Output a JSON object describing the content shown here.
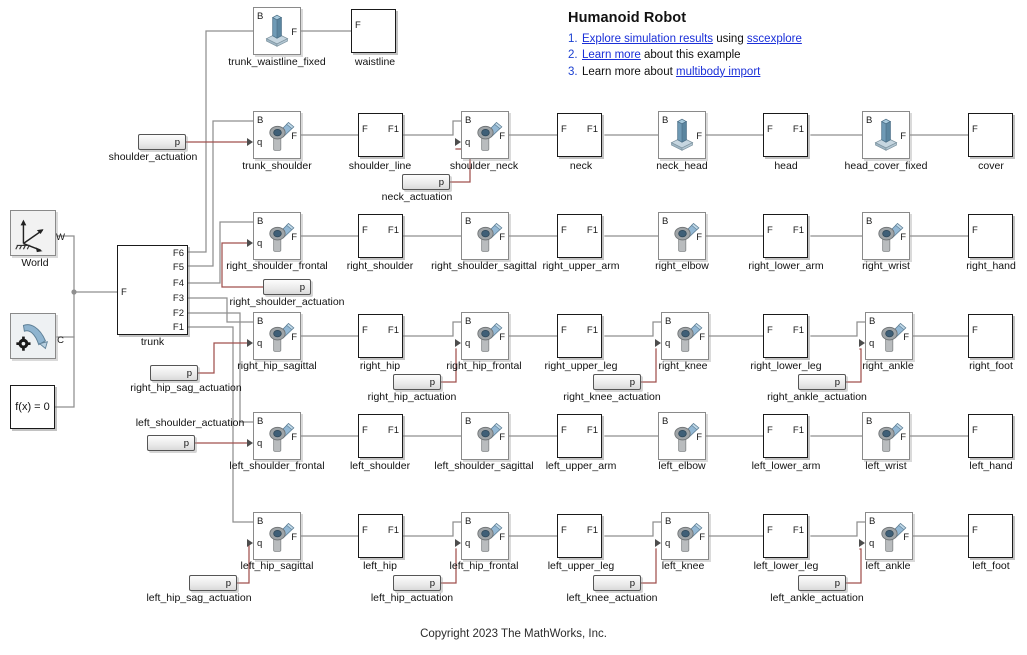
{
  "note": {
    "title": "Humanoid Robot",
    "items": [
      {
        "num": "1.",
        "parts": [
          {
            "t": "Explore simulation results",
            "link": true
          },
          {
            "t": " using ",
            "link": false
          },
          {
            "t": "sscexplore",
            "link": true
          }
        ]
      },
      {
        "num": "2.",
        "parts": [
          {
            "t": "Learn more",
            "link": true
          },
          {
            "t": " about this example",
            "link": false
          }
        ]
      },
      {
        "num": "3.",
        "parts": [
          {
            "t": "Learn more about ",
            "link": false
          },
          {
            "t": "multibody import",
            "link": true
          }
        ]
      }
    ]
  },
  "copyright": "Copyright 2023 The MathWorks, Inc.",
  "colors": {
    "wire_physical": "#8f8f8f",
    "wire_signal": "#a0504e",
    "link": "#1a2fd8",
    "block_border_body": "#1a1a1a",
    "block_border_joint": "#8a8a8a",
    "icon_blue": "#7ba7c7",
    "background": "#ffffff"
  },
  "source_blocks": {
    "world": {
      "caption": "World",
      "port_w": "W"
    },
    "mechanism_config": {
      "caption": "",
      "port_c": "C"
    },
    "solver": {
      "caption": "",
      "label": "f(x) = 0"
    }
  },
  "trunk": {
    "caption": "trunk",
    "in_port": "F",
    "out_ports": [
      "F6",
      "F5",
      "F4",
      "F3",
      "F2",
      "F1"
    ]
  },
  "blocks": [
    {
      "name": "trunk_waistline_fixed",
      "caption": "trunk_waistline_fixed",
      "kind": "solid",
      "ports": {
        "left": "B",
        "right": "F"
      }
    },
    {
      "name": "waistline",
      "caption": "waistline",
      "kind": "body",
      "ports": {
        "left": "F",
        "right": ""
      }
    },
    {
      "name": "trunk_shoulder",
      "caption": "trunk_shoulder",
      "kind": "joint",
      "ports": {
        "left": "B",
        "right": "F",
        "signal": "q"
      }
    },
    {
      "name": "shoulder_line",
      "caption": "shoulder_line",
      "kind": "body",
      "ports": {
        "left": "F",
        "right": "F1"
      }
    },
    {
      "name": "shoulder_neck",
      "caption": "shoulder_neck",
      "kind": "joint",
      "ports": {
        "left": "B",
        "right": "F",
        "signal": "q"
      }
    },
    {
      "name": "neck",
      "caption": "neck",
      "kind": "body",
      "ports": {
        "left": "F",
        "right": "F1"
      }
    },
    {
      "name": "neck_head",
      "caption": "neck_head",
      "kind": "solid",
      "ports": {
        "left": "B",
        "right": "F"
      }
    },
    {
      "name": "head",
      "caption": "head",
      "kind": "body",
      "ports": {
        "left": "F",
        "right": "F1"
      }
    },
    {
      "name": "head_cover_fixed",
      "caption": "head_cover_fixed",
      "kind": "solid",
      "ports": {
        "left": "B",
        "right": "F"
      }
    },
    {
      "name": "cover",
      "caption": "cover",
      "kind": "body",
      "ports": {
        "left": "F",
        "right": ""
      }
    },
    {
      "name": "right_shoulder_frontal",
      "caption": "right_shoulder_frontal",
      "kind": "joint",
      "ports": {
        "left": "B",
        "right": "F",
        "signal": "q"
      }
    },
    {
      "name": "right_shoulder",
      "caption": "right_shoulder",
      "kind": "body",
      "ports": {
        "left": "F",
        "right": "F1"
      }
    },
    {
      "name": "right_shoulder_sagittal",
      "caption": "right_shoulder_sagittal",
      "kind": "joint",
      "ports": {
        "left": "B",
        "right": "F"
      }
    },
    {
      "name": "right_upper_arm",
      "caption": "right_upper_arm",
      "kind": "body",
      "ports": {
        "left": "F",
        "right": "F1"
      }
    },
    {
      "name": "right_elbow",
      "caption": "right_elbow",
      "kind": "joint",
      "ports": {
        "left": "B",
        "right": "F"
      }
    },
    {
      "name": "right_lower_arm",
      "caption": "right_lower_arm",
      "kind": "body",
      "ports": {
        "left": "F",
        "right": "F1"
      }
    },
    {
      "name": "right_wrist",
      "caption": "right_wrist",
      "kind": "joint",
      "ports": {
        "left": "B",
        "right": "F"
      }
    },
    {
      "name": "right_hand",
      "caption": "right_hand",
      "kind": "body",
      "ports": {
        "left": "F",
        "right": ""
      }
    },
    {
      "name": "right_hip_sagittal",
      "caption": "right_hip_sagittal",
      "kind": "joint",
      "ports": {
        "left": "B",
        "right": "F",
        "signal": "q"
      }
    },
    {
      "name": "right_hip",
      "caption": "right_hip",
      "kind": "body",
      "ports": {
        "left": "F",
        "right": "F1"
      }
    },
    {
      "name": "right_hip_frontal",
      "caption": "right_hip_frontal",
      "kind": "joint",
      "ports": {
        "left": "B",
        "right": "F",
        "signal": "q"
      }
    },
    {
      "name": "right_upper_leg",
      "caption": "right_upper_leg",
      "kind": "body",
      "ports": {
        "left": "F",
        "right": "F1"
      }
    },
    {
      "name": "right_knee",
      "caption": "right_knee",
      "kind": "joint",
      "ports": {
        "left": "B",
        "right": "F",
        "signal": "q"
      }
    },
    {
      "name": "right_lower_leg",
      "caption": "right_lower_leg",
      "kind": "body",
      "ports": {
        "left": "F",
        "right": "F1"
      }
    },
    {
      "name": "right_ankle",
      "caption": "right_ankle",
      "kind": "joint",
      "ports": {
        "left": "B",
        "right": "F",
        "signal": "q"
      }
    },
    {
      "name": "right_foot",
      "caption": "right_foot",
      "kind": "body",
      "ports": {
        "left": "F",
        "right": ""
      }
    },
    {
      "name": "left_shoulder_frontal",
      "caption": "left_shoulder_frontal",
      "kind": "joint",
      "ports": {
        "left": "B",
        "right": "F",
        "signal": "q"
      }
    },
    {
      "name": "left_shoulder",
      "caption": "left_shoulder",
      "kind": "body",
      "ports": {
        "left": "F",
        "right": "F1"
      }
    },
    {
      "name": "left_shoulder_sagittal",
      "caption": "left_shoulder_sagittal",
      "kind": "joint",
      "ports": {
        "left": "B",
        "right": "F"
      }
    },
    {
      "name": "left_upper_arm",
      "caption": "left_upper_arm",
      "kind": "body",
      "ports": {
        "left": "F",
        "right": "F1"
      }
    },
    {
      "name": "left_elbow",
      "caption": "left_elbow",
      "kind": "joint",
      "ports": {
        "left": "B",
        "right": "F"
      }
    },
    {
      "name": "left_lower_arm",
      "caption": "left_lower_arm",
      "kind": "body",
      "ports": {
        "left": "F",
        "right": "F1"
      }
    },
    {
      "name": "left_wrist",
      "caption": "left_wrist",
      "kind": "joint",
      "ports": {
        "left": "B",
        "right": "F"
      }
    },
    {
      "name": "left_hand",
      "caption": "left_hand",
      "kind": "body",
      "ports": {
        "left": "F",
        "right": ""
      }
    },
    {
      "name": "left_hip_sagittal",
      "caption": "left_hip_sagittal",
      "kind": "joint",
      "ports": {
        "left": "B",
        "right": "F",
        "signal": "q"
      }
    },
    {
      "name": "left_hip",
      "caption": "left_hip",
      "kind": "body",
      "ports": {
        "left": "F",
        "right": "F1"
      }
    },
    {
      "name": "left_hip_frontal",
      "caption": "left_hip_frontal",
      "kind": "joint",
      "ports": {
        "left": "B",
        "right": "F",
        "signal": "q"
      }
    },
    {
      "name": "left_upper_leg",
      "caption": "left_upper_leg",
      "kind": "body",
      "ports": {
        "left": "F",
        "right": "F1"
      }
    },
    {
      "name": "left_knee",
      "caption": "left_knee",
      "kind": "joint",
      "ports": {
        "left": "B",
        "right": "F",
        "signal": "q"
      }
    },
    {
      "name": "left_lower_leg",
      "caption": "left_lower_leg",
      "kind": "body",
      "ports": {
        "left": "F",
        "right": "F1"
      }
    },
    {
      "name": "left_ankle",
      "caption": "left_ankle",
      "kind": "joint",
      "ports": {
        "left": "B",
        "right": "F",
        "signal": "q"
      }
    },
    {
      "name": "left_foot",
      "caption": "left_foot",
      "kind": "body",
      "ports": {
        "left": "F",
        "right": ""
      }
    }
  ],
  "actuations": [
    {
      "name": "shoulder_actuation",
      "caption": "shoulder_actuation",
      "port": "p"
    },
    {
      "name": "neck_actuation",
      "caption": "neck_actuation",
      "port": "p"
    },
    {
      "name": "right_shoulder_actuation",
      "caption": "right_shoulder_actuation",
      "port": "p"
    },
    {
      "name": "right_hip_sag_actuation",
      "caption": "right_hip_sag_actuation",
      "port": "p"
    },
    {
      "name": "right_hip_actuation",
      "caption": "right_hip_actuation",
      "port": "p"
    },
    {
      "name": "right_knee_actuation",
      "caption": "right_knee_actuation",
      "port": "p"
    },
    {
      "name": "right_ankle_actuation",
      "caption": "right_ankle_actuation",
      "port": "p"
    },
    {
      "name": "left_shoulder_actuation",
      "caption": "left_shoulder_actuation",
      "port": "p"
    },
    {
      "name": "left_hip_sag_actuation",
      "caption": "left_hip_sag_actuation",
      "port": "p"
    },
    {
      "name": "left_hip_actuation",
      "caption": "left_hip_actuation",
      "port": "p"
    },
    {
      "name": "left_knee_actuation",
      "caption": "left_knee_actuation",
      "port": "p"
    },
    {
      "name": "left_ankle_actuation",
      "caption": "left_ankle_actuation",
      "port": "p"
    }
  ]
}
